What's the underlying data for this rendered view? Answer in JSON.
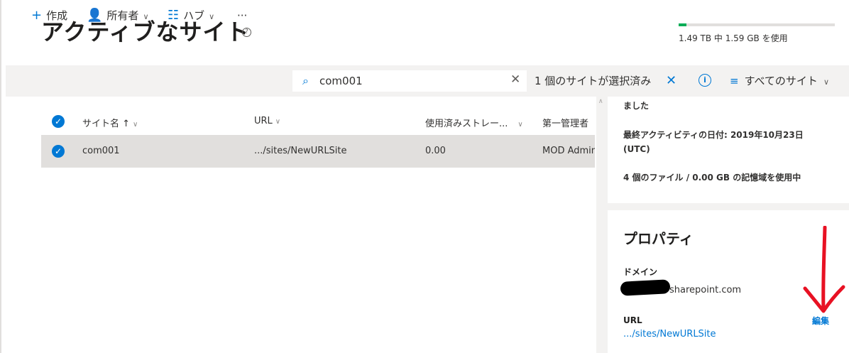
{
  "header": {
    "title": "アクティブなサイト",
    "help_icon": "question-circle-icon",
    "storage_text": "1.49 TB 中 1.59 GB を使用",
    "storage_fraction": 0.05
  },
  "toolbar": {
    "create_label": "作成",
    "owner_label": "所有者",
    "hub_label": "ハブ",
    "more_label": "···",
    "search_value": "com001",
    "selection_text": "1 個のサイトが選択済み",
    "view_label": "すべてのサイト"
  },
  "list": {
    "columns": [
      "サイト名 ↑",
      "URL",
      "使用済みストレー...",
      "第一管理者"
    ],
    "rows": [
      {
        "name": "com001",
        "url": ".../sites/NewURLSite",
        "storage": "0.00",
        "admin": "MOD Admini"
      }
    ]
  },
  "panel": {
    "partial_text": "ました",
    "last_activity_line1": "最終アクティビティの日付: 2019年10月23日",
    "last_activity_line2": "(UTC)",
    "files_usage": "4 個のファイル / 0.00 GB の記憶域を使用中",
    "properties_title": "プロパティ",
    "domain_label": "ドメイン",
    "domain_value": "sharepoint.com",
    "url_label": "URL",
    "url_value": ".../sites/NewURLSite",
    "edit_label": "編集"
  },
  "colors": {
    "accent": "#0078d4",
    "storage_fill": "#00ad56",
    "annotation_arrow": "#e81123"
  }
}
